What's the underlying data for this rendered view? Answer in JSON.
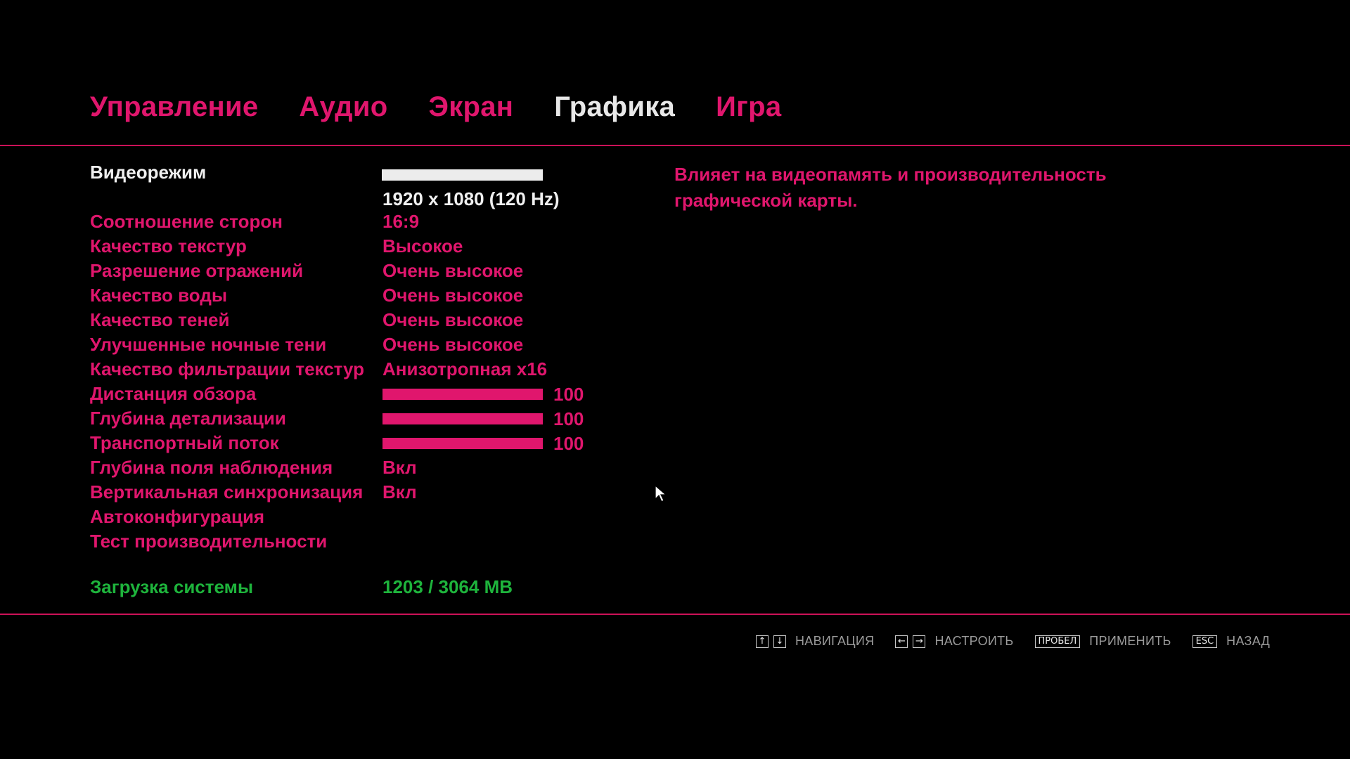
{
  "tabs": [
    {
      "label": "Управление"
    },
    {
      "label": "Аудио"
    },
    {
      "label": "Экран"
    },
    {
      "label": "Графика"
    },
    {
      "label": "Игра"
    }
  ],
  "active_tab": "Графика",
  "settings": {
    "videomode": {
      "label": "Видеорежим",
      "value": "1920 x 1080 (120 Hz)"
    },
    "aspect": {
      "label": "Соотношение сторон",
      "value": "16:9"
    },
    "texture_quality": {
      "label": "Качество текстур",
      "value": "Высокое"
    },
    "reflection_res": {
      "label": "Разрешение отражений",
      "value": "Очень высокое"
    },
    "water_quality": {
      "label": "Качество воды",
      "value": "Очень высокое"
    },
    "shadow_quality": {
      "label": "Качество теней",
      "value": "Очень высокое"
    },
    "night_shadows": {
      "label": "Улучшенные ночные тени",
      "value": "Очень высокое"
    },
    "texture_filter": {
      "label": "Качество фильтрации текстур",
      "value": "Анизотропная x16"
    },
    "view_distance": {
      "label": "Дистанция обзора",
      "value": "100"
    },
    "detail_distance": {
      "label": "Глубина детализации",
      "value": "100"
    },
    "traffic": {
      "label": "Транспортный поток",
      "value": "100"
    },
    "dof": {
      "label": "Глубина поля наблюдения",
      "value": "Вкл"
    },
    "vsync": {
      "label": "Вертикальная синхронизация",
      "value": "Вкл"
    },
    "autoconfig": {
      "label": "Автоконфигурация"
    },
    "benchmark": {
      "label": "Тест производительности"
    }
  },
  "system_load": {
    "label": "Загрузка системы",
    "value": "1203 / 3064 MB"
  },
  "description": {
    "line1": "Влияет на видеопамять и производительность",
    "line2": "графической карты."
  },
  "hints": {
    "navigate": {
      "label": "НАВИГАЦИЯ"
    },
    "adjust": {
      "label": "НАСТРОИТЬ"
    },
    "apply": {
      "key": "ПРОБЕЛ",
      "label": "ПРИМЕНИТЬ"
    },
    "back": {
      "key": "ESC",
      "label": "НАЗАД"
    }
  },
  "colors": {
    "accent": "#e0166d",
    "selected": "#f0f0f0",
    "system_load": "#1eb43c",
    "background": "#000000"
  }
}
